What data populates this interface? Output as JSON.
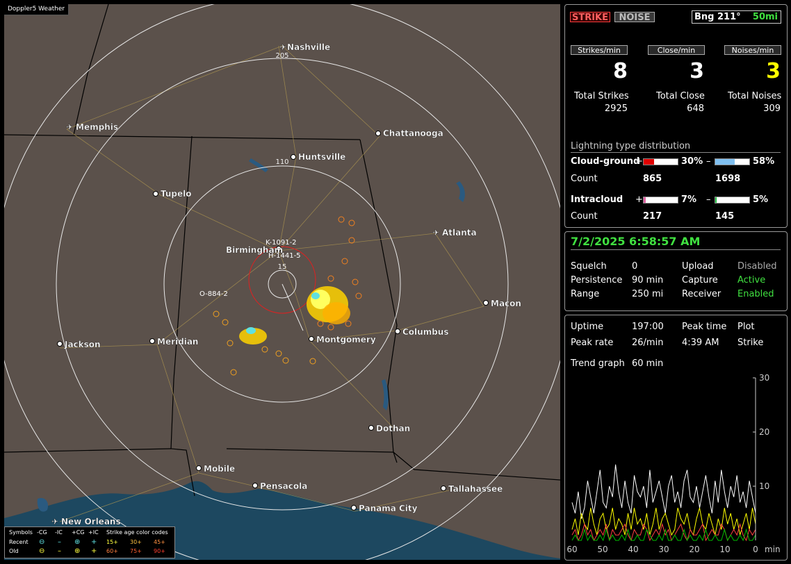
{
  "app": {
    "title": "Doppler5 Weather"
  },
  "header": {
    "strike_label": "STRIKE",
    "noise_label": "NOISE",
    "bearing": "Bng 211°",
    "range": "50mi"
  },
  "rates": {
    "strikes_label": "Strikes/min",
    "strikes_value": "8",
    "close_label": "Close/min",
    "close_value": "3",
    "noises_label": "Noises/min",
    "noises_value": "3"
  },
  "totals": {
    "strikes_label": "Total Strikes",
    "strikes_value": "2925",
    "close_label": "Total Close",
    "close_value": "648",
    "noises_label": "Total Noises",
    "noises_value": "309"
  },
  "distribution": {
    "title": "Lightning type distribution",
    "cg_label": "Cloud-ground",
    "cg_pos_sign": "+",
    "cg_pos_pct": "30%",
    "cg_neg_sign": "–",
    "cg_neg_pct": "58%",
    "cg_count_label": "Count",
    "cg_pos_count": "865",
    "cg_neg_count": "1698",
    "ic_label": "Intracloud",
    "ic_pos_sign": "+",
    "ic_pos_pct": "7%",
    "ic_neg_sign": "–",
    "ic_neg_pct": "5%",
    "ic_count_label": "Count",
    "ic_pos_count": "217",
    "ic_neg_count": "145",
    "cg_pos_frac": 0.3,
    "cg_neg_frac": 0.58,
    "ic_pos_frac": 0.07,
    "ic_neg_frac": 0.05
  },
  "status": {
    "datetime": "7/2/2025 6:58:57 AM",
    "squelch_label": "Squelch",
    "squelch_value": "0",
    "persistence_label": "Persistence",
    "persistence_value": "90 min",
    "range_label": "Range",
    "range_value": "250 mi",
    "upload_label": "Upload",
    "upload_value": "Disabled",
    "capture_label": "Capture",
    "capture_value": "Active",
    "receiver_label": "Receiver",
    "receiver_value": "Enabled"
  },
  "stats": {
    "uptime_label": "Uptime",
    "uptime_value": "197:00",
    "peak_time_label": "Peak time",
    "peak_time_value": "4:39 AM",
    "plot_label": "Plot",
    "plot_value": "Strike",
    "peak_rate_label": "Peak rate",
    "peak_rate_value": "26/min",
    "trend_label": "Trend graph",
    "trend_value": "60 min"
  },
  "chart_data": {
    "type": "line",
    "xlabel": "min",
    "x_ticks": [
      "60",
      "50",
      "40",
      "30",
      "20",
      "10",
      "0"
    ],
    "y_ticks": [
      "30",
      "20",
      "10"
    ],
    "xlim": [
      60,
      0
    ],
    "ylim": [
      0,
      30
    ],
    "series": [
      {
        "color": "#ffffff",
        "values": [
          7,
          5,
          9,
          4,
          6,
          11,
          8,
          5,
          9,
          13,
          7,
          6,
          10,
          8,
          14,
          9,
          6,
          11,
          7,
          5,
          12,
          9,
          8,
          10,
          6,
          13,
          7,
          9,
          11,
          8,
          5,
          10,
          12,
          7,
          9,
          6,
          11,
          13,
          8,
          7,
          10,
          6,
          9,
          12,
          8,
          5,
          11,
          7,
          13,
          9,
          6,
          10,
          8,
          12,
          7,
          9,
          6,
          11,
          8,
          5
        ]
      },
      {
        "color": "#ffff00",
        "values": [
          2,
          4,
          1,
          5,
          3,
          2,
          6,
          3,
          1,
          4,
          5,
          2,
          3,
          6,
          2,
          4,
          3,
          1,
          5,
          2,
          6,
          3,
          4,
          2,
          5,
          1,
          3,
          6,
          2,
          4,
          5,
          3,
          1,
          2,
          6,
          4,
          3,
          5,
          2,
          1,
          4,
          6,
          3,
          2,
          5,
          3,
          1,
          4,
          2,
          6,
          3,
          5,
          2,
          4,
          1,
          3,
          5,
          2,
          6,
          3
        ]
      },
      {
        "color": "#ff4040",
        "values": [
          1,
          2,
          0,
          1,
          3,
          1,
          2,
          0,
          1,
          2,
          1,
          3,
          0,
          2,
          1,
          1,
          2,
          3,
          1,
          0,
          2,
          1,
          1,
          3,
          2,
          0,
          1,
          2,
          1,
          3,
          1,
          2,
          0,
          1,
          2,
          3,
          1,
          0,
          2,
          1,
          1,
          2,
          3,
          0,
          1,
          2,
          1,
          1,
          3,
          2,
          0,
          1,
          2,
          1,
          3,
          1,
          0,
          2,
          1,
          2
        ]
      },
      {
        "color": "#00c000",
        "values": [
          0,
          1,
          0,
          0,
          2,
          0,
          1,
          0,
          0,
          1,
          0,
          2,
          0,
          1,
          0,
          0,
          1,
          0,
          2,
          0,
          0,
          1,
          0,
          0,
          2,
          1,
          0,
          0,
          1,
          0,
          2,
          0,
          0,
          1,
          0,
          0,
          2,
          0,
          1,
          0,
          0,
          1,
          0,
          2,
          0,
          0,
          1,
          0,
          0,
          2,
          0,
          1,
          0,
          0,
          1,
          0,
          2,
          0,
          0,
          1
        ]
      }
    ]
  },
  "map": {
    "cities": [
      "Nashville",
      "Memphis",
      "Chattanooga",
      "Huntsville",
      "Tupelo",
      "Atlanta",
      "Birmingham",
      "Macon",
      "Jackson",
      "Meridian",
      "Montgomery",
      "Columbus",
      "Dothan",
      "Mobile",
      "Pensacola",
      "Tallahassee",
      "Panama City",
      "New Orleans"
    ],
    "range_labels": [
      "205",
      "110",
      "15"
    ],
    "storm_labels": [
      "K-1091-2",
      "H-1441-5",
      "O-884-2"
    ]
  },
  "legend": {
    "symbols_label": "Symbols",
    "neg_cg": "-CG",
    "neg_ic": "-IC",
    "pos_cg": "+CG",
    "pos_ic": "+IC",
    "age_label": "Strike age color codes",
    "recent_label": "Recent",
    "old_label": "Old",
    "age_15": "15+",
    "age_30": "30+",
    "age_45": "45+",
    "age_60": "60+",
    "age_75": "75+",
    "age_90": "90+"
  }
}
